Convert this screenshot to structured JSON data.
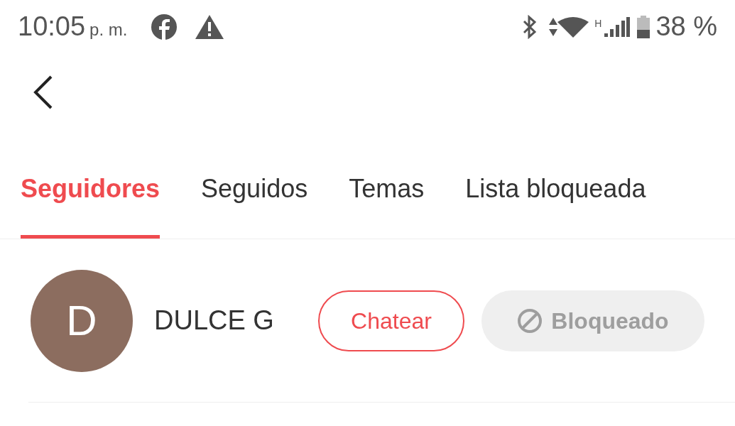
{
  "status_bar": {
    "time": "10:05",
    "period": "p. m.",
    "network_type": "H",
    "battery": "38 %"
  },
  "tabs": [
    {
      "label": "Seguidores",
      "selected": true
    },
    {
      "label": "Seguidos",
      "selected": false
    },
    {
      "label": "Temas",
      "selected": false
    },
    {
      "label": "Lista bloqueada",
      "selected": false
    }
  ],
  "followers": [
    {
      "initial": "D",
      "name": "DULCE G",
      "chat_button": "Chatear",
      "block_button": "Bloqueado",
      "blocked": true
    }
  ]
}
